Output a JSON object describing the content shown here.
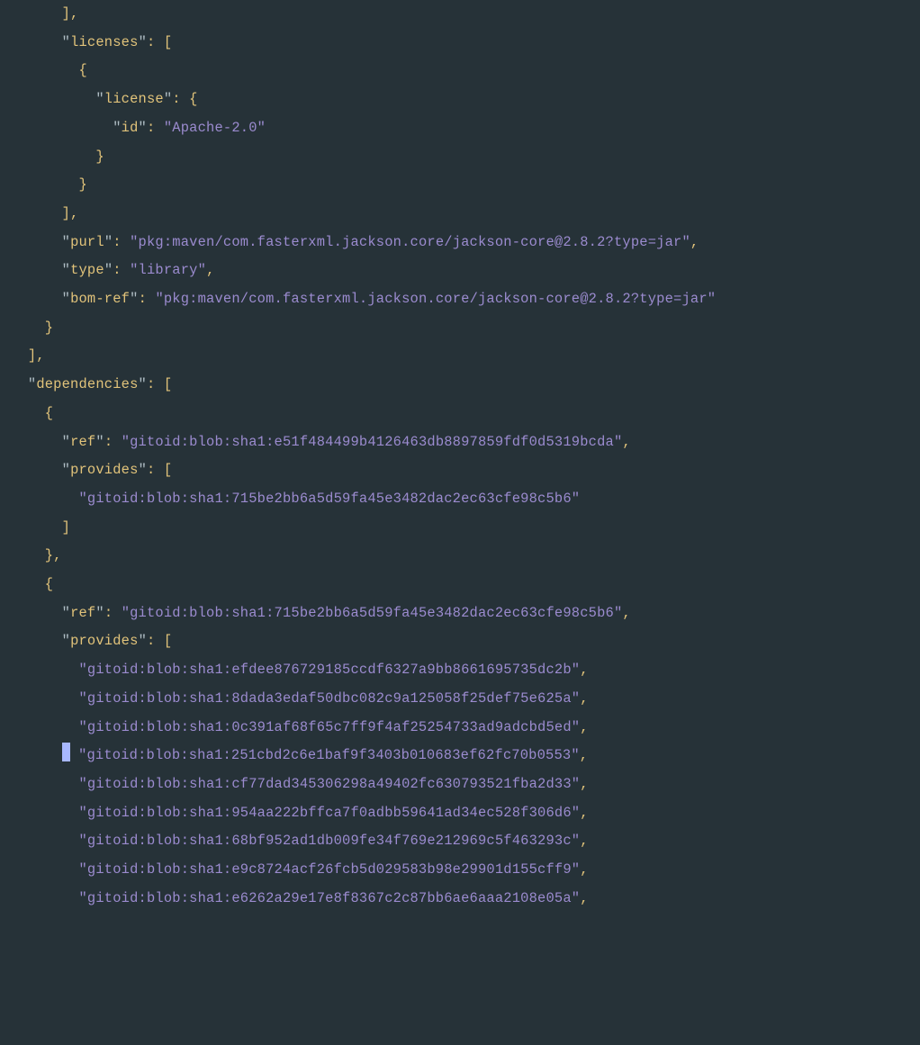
{
  "lines": [
    {
      "indent": 6,
      "tokens": [
        {
          "t": "punct",
          "v": "],"
        }
      ]
    },
    {
      "indent": 6,
      "tokens": [
        {
          "t": "kquote",
          "v": "\""
        },
        {
          "t": "key",
          "v": "licenses"
        },
        {
          "t": "kquote",
          "v": "\""
        },
        {
          "t": "punct",
          "v": ": ["
        }
      ]
    },
    {
      "indent": 8,
      "tokens": [
        {
          "t": "punct",
          "v": "{"
        }
      ]
    },
    {
      "indent": 10,
      "tokens": [
        {
          "t": "kquote",
          "v": "\""
        },
        {
          "t": "key",
          "v": "license"
        },
        {
          "t": "kquote",
          "v": "\""
        },
        {
          "t": "punct",
          "v": ": {"
        }
      ]
    },
    {
      "indent": 12,
      "tokens": [
        {
          "t": "kquote",
          "v": "\""
        },
        {
          "t": "key",
          "v": "id"
        },
        {
          "t": "kquote",
          "v": "\""
        },
        {
          "t": "punct",
          "v": ": "
        },
        {
          "t": "string",
          "v": "\"Apache-2.0\""
        }
      ]
    },
    {
      "indent": 10,
      "tokens": [
        {
          "t": "punct",
          "v": "}"
        }
      ]
    },
    {
      "indent": 8,
      "tokens": [
        {
          "t": "punct",
          "v": "}"
        }
      ]
    },
    {
      "indent": 6,
      "tokens": [
        {
          "t": "punct",
          "v": "],"
        }
      ]
    },
    {
      "indent": 6,
      "tokens": [
        {
          "t": "kquote",
          "v": "\""
        },
        {
          "t": "key",
          "v": "purl"
        },
        {
          "t": "kquote",
          "v": "\""
        },
        {
          "t": "punct",
          "v": ": "
        },
        {
          "t": "string",
          "v": "\"pkg:maven/com.fasterxml.jackson.core/jackson-core@2.8.2?type=jar\""
        },
        {
          "t": "punct",
          "v": ","
        }
      ]
    },
    {
      "indent": 6,
      "tokens": [
        {
          "t": "kquote",
          "v": "\""
        },
        {
          "t": "key",
          "v": "type"
        },
        {
          "t": "kquote",
          "v": "\""
        },
        {
          "t": "punct",
          "v": ": "
        },
        {
          "t": "string",
          "v": "\"library\""
        },
        {
          "t": "punct",
          "v": ","
        }
      ]
    },
    {
      "indent": 6,
      "tokens": [
        {
          "t": "kquote",
          "v": "\""
        },
        {
          "t": "key",
          "v": "bom-ref"
        },
        {
          "t": "kquote",
          "v": "\""
        },
        {
          "t": "punct",
          "v": ": "
        },
        {
          "t": "string",
          "v": "\"pkg:maven/com.fasterxml.jackson.core/jackson-core@2.8.2?type=jar\""
        }
      ]
    },
    {
      "indent": 4,
      "tokens": [
        {
          "t": "punct",
          "v": "}"
        }
      ]
    },
    {
      "indent": 2,
      "tokens": [
        {
          "t": "punct",
          "v": "],"
        }
      ]
    },
    {
      "indent": 2,
      "tokens": [
        {
          "t": "kquote",
          "v": "\""
        },
        {
          "t": "key",
          "v": "dependencies"
        },
        {
          "t": "kquote",
          "v": "\""
        },
        {
          "t": "punct",
          "v": ": ["
        }
      ]
    },
    {
      "indent": 4,
      "tokens": [
        {
          "t": "punct",
          "v": "{"
        }
      ]
    },
    {
      "indent": 6,
      "tokens": [
        {
          "t": "kquote",
          "v": "\""
        },
        {
          "t": "key",
          "v": "ref"
        },
        {
          "t": "kquote",
          "v": "\""
        },
        {
          "t": "punct",
          "v": ": "
        },
        {
          "t": "string",
          "v": "\"gitoid:blob:sha1:e51f484499b4126463db8897859fdf0d5319bcda\""
        },
        {
          "t": "punct",
          "v": ","
        }
      ]
    },
    {
      "indent": 6,
      "tokens": [
        {
          "t": "kquote",
          "v": "\""
        },
        {
          "t": "key",
          "v": "provides"
        },
        {
          "t": "kquote",
          "v": "\""
        },
        {
          "t": "punct",
          "v": ": ["
        }
      ]
    },
    {
      "indent": 8,
      "tokens": [
        {
          "t": "string",
          "v": "\"gitoid:blob:sha1:715be2bb6a5d59fa45e3482dac2ec63cfe98c5b6\""
        }
      ]
    },
    {
      "indent": 6,
      "tokens": [
        {
          "t": "punct",
          "v": "]"
        }
      ]
    },
    {
      "indent": 4,
      "tokens": [
        {
          "t": "punct",
          "v": "},"
        }
      ]
    },
    {
      "indent": 4,
      "tokens": [
        {
          "t": "punct",
          "v": "{"
        }
      ]
    },
    {
      "indent": 6,
      "tokens": [
        {
          "t": "kquote",
          "v": "\""
        },
        {
          "t": "key",
          "v": "ref"
        },
        {
          "t": "kquote",
          "v": "\""
        },
        {
          "t": "punct",
          "v": ": "
        },
        {
          "t": "string",
          "v": "\"gitoid:blob:sha1:715be2bb6a5d59fa45e3482dac2ec63cfe98c5b6\""
        },
        {
          "t": "punct",
          "v": ","
        }
      ]
    },
    {
      "indent": 6,
      "tokens": [
        {
          "t": "kquote",
          "v": "\""
        },
        {
          "t": "key",
          "v": "provides"
        },
        {
          "t": "kquote",
          "v": "\""
        },
        {
          "t": "punct",
          "v": ": ["
        }
      ]
    },
    {
      "indent": 8,
      "tokens": [
        {
          "t": "string",
          "v": "\"gitoid:blob:sha1:efdee876729185ccdf6327a9bb8661695735dc2b\""
        },
        {
          "t": "punct",
          "v": ","
        }
      ]
    },
    {
      "indent": 8,
      "tokens": [
        {
          "t": "string",
          "v": "\"gitoid:blob:sha1:8dada3edaf50dbc082c9a125058f25def75e625a\""
        },
        {
          "t": "punct",
          "v": ","
        }
      ]
    },
    {
      "indent": 8,
      "tokens": [
        {
          "t": "string",
          "v": "\"gitoid:blob:sha1:0c391af68f65c7ff9f4af25254733ad9adcbd5ed\""
        },
        {
          "t": "punct",
          "v": ","
        }
      ]
    },
    {
      "indent": 6,
      "cursor": true,
      "tokens": [
        {
          "t": "string",
          "v": "\"gitoid:blob:sha1:251cbd2c6e1baf9f3403b010683ef62fc70b0553\""
        },
        {
          "t": "punct",
          "v": ","
        }
      ]
    },
    {
      "indent": 8,
      "tokens": [
        {
          "t": "string",
          "v": "\"gitoid:blob:sha1:cf77dad345306298a49402fc630793521fba2d33\""
        },
        {
          "t": "punct",
          "v": ","
        }
      ]
    },
    {
      "indent": 8,
      "tokens": [
        {
          "t": "string",
          "v": "\"gitoid:blob:sha1:954aa222bffca7f0adbb59641ad34ec528f306d6\""
        },
        {
          "t": "punct",
          "v": ","
        }
      ]
    },
    {
      "indent": 8,
      "tokens": [
        {
          "t": "string",
          "v": "\"gitoid:blob:sha1:68bf952ad1db009fe34f769e212969c5f463293c\""
        },
        {
          "t": "punct",
          "v": ","
        }
      ]
    },
    {
      "indent": 8,
      "tokens": [
        {
          "t": "string",
          "v": "\"gitoid:blob:sha1:e9c8724acf26fcb5d029583b98e29901d155cff9\""
        },
        {
          "t": "punct",
          "v": ","
        }
      ]
    },
    {
      "indent": 8,
      "tokens": [
        {
          "t": "string",
          "v": "\"gitoid:blob:sha1:e6262a29e17e8f8367c2c87bb6ae6aaa2108e05a\""
        },
        {
          "t": "punct",
          "v": ","
        }
      ]
    }
  ]
}
